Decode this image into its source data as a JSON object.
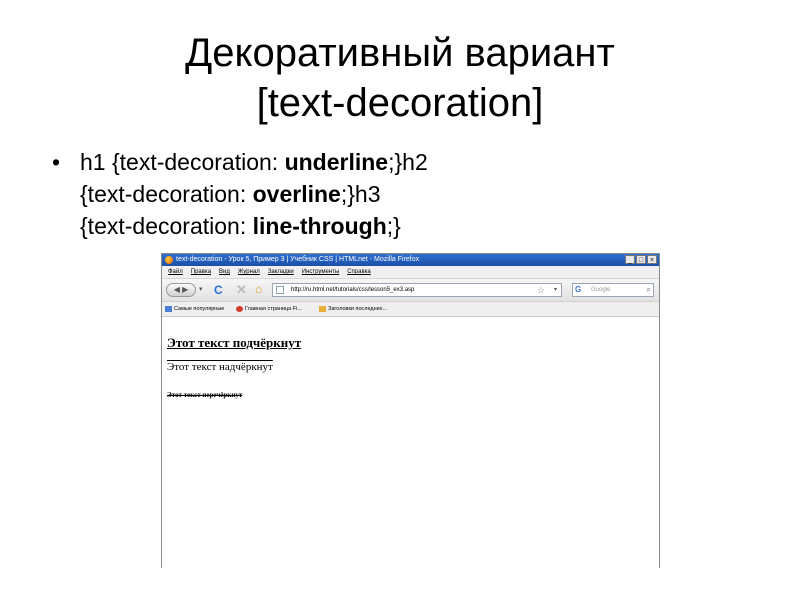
{
  "slide": {
    "title_line1": "Декоративный вариант",
    "title_line2": "[text-decoration]",
    "bullet_marker": "•",
    "bullet": {
      "p1": "h1 {text-decoration: ",
      "b1": "underline",
      "p2": ";}h2",
      "p3": "{text-decoration: ",
      "b2": "overline",
      "p4": ";}h3",
      "p5": "{text-decoration: ",
      "b3": "line-through",
      "p6": ";}"
    }
  },
  "browser": {
    "window_title": "text-decoration - Урок 5, Пример 3 | Учебник CSS | HTMLnet - Mozilla Firefox",
    "window_buttons": [
      "_",
      "□",
      "×"
    ],
    "menu": [
      "Файл",
      "Правка",
      "Вид",
      "Журнал",
      "Закладки",
      "Инструменты",
      "Справка"
    ],
    "nav": {
      "back_glyph": "◀ ▶",
      "dropdown_glyph": "▾",
      "reload_glyph": "C",
      "stop_glyph": "✕",
      "home_glyph": "⌂"
    },
    "url": "http://ru.html.net/tutorials/css/lesson5_ex3.asp",
    "url_star": "☆",
    "url_dropdown": "▾",
    "search_engine": "G",
    "search_placeholder": "Google",
    "search_icon": "⌕",
    "bookmarks": [
      "Самые популярные",
      "Главная страница Fi...",
      "Заголовки последних..."
    ],
    "page": {
      "h1": "Этот текст подчёркнут",
      "h2": "Этот текст надчёркнут",
      "h3": "Этот текст перечёркнут"
    }
  }
}
